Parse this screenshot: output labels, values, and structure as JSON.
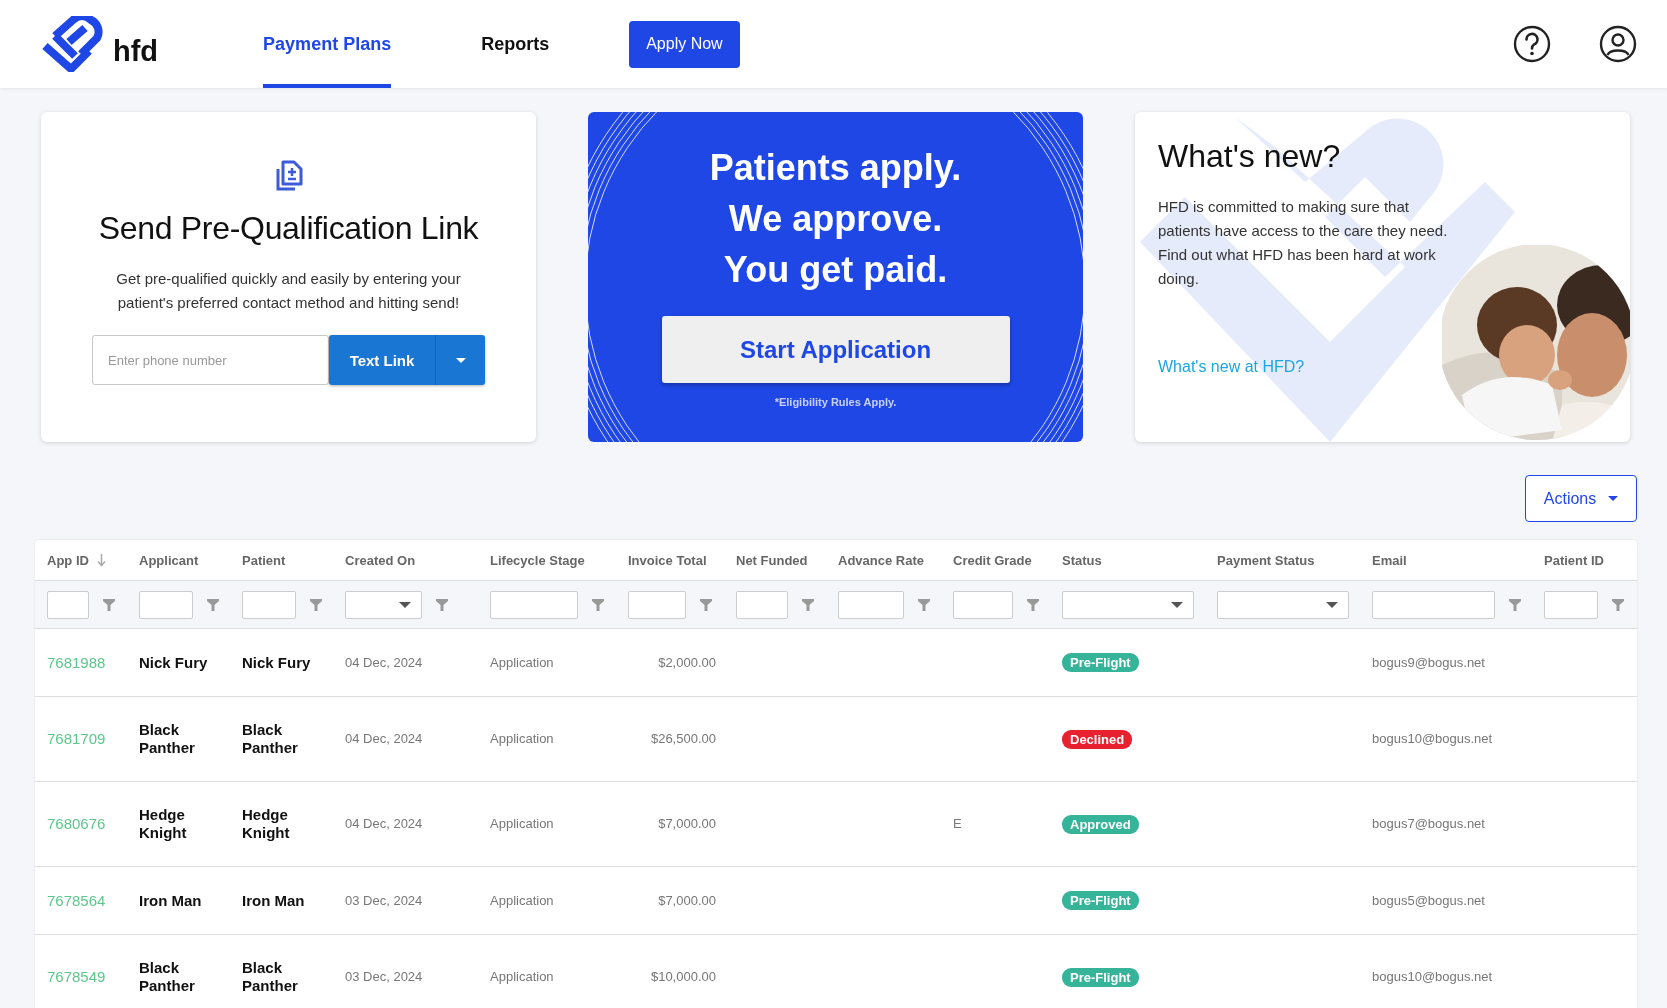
{
  "header": {
    "logo_text": "hfd",
    "nav": [
      {
        "label": "Payment Plans",
        "selected": true
      },
      {
        "label": "Reports",
        "selected": false
      }
    ],
    "apply_button": "Apply Now"
  },
  "prequal_card": {
    "title": "Send Pre-Qualification Link",
    "description": "Get pre-qualified quickly and easily by entering your patient's preferred contact method and hitting send!",
    "phone_placeholder": "Enter phone number",
    "button": "Text Link"
  },
  "promo_card": {
    "lines": [
      "Patients apply.",
      "We approve.",
      "You get paid."
    ],
    "button": "Start Application",
    "footnote": "*Eligibility Rules Apply."
  },
  "news_card": {
    "title": "What's new?",
    "body": "HFD is committed to making sure that patients have access to the care they need. Find out what HFD has been hard at work doing.",
    "link": "What's new at HFD?"
  },
  "actions_button": "Actions",
  "table": {
    "columns": [
      {
        "label": "App ID",
        "sorted": true,
        "kind": "text"
      },
      {
        "label": "Applicant",
        "sorted": false,
        "kind": "text"
      },
      {
        "label": "Patient",
        "sorted": false,
        "kind": "text"
      },
      {
        "label": "Created On",
        "sorted": false,
        "kind": "date"
      },
      {
        "label": "Lifecycle Stage",
        "sorted": false,
        "kind": "text"
      },
      {
        "label": "Invoice Total",
        "sorted": false,
        "kind": "text"
      },
      {
        "label": "Net Funded",
        "sorted": false,
        "kind": "text"
      },
      {
        "label": "Advance Rate",
        "sorted": false,
        "kind": "text"
      },
      {
        "label": "Credit Grade",
        "sorted": false,
        "kind": "text"
      },
      {
        "label": "Status",
        "sorted": false,
        "kind": "choice"
      },
      {
        "label": "Payment Status",
        "sorted": false,
        "kind": "choice"
      },
      {
        "label": "Email",
        "sorted": false,
        "kind": "text"
      },
      {
        "label": "Patient ID",
        "sorted": false,
        "kind": "text"
      }
    ],
    "rows": [
      {
        "app_id": "7681988",
        "applicant": "Nick Fury",
        "patient": "Nick Fury",
        "created_on": "04 Dec, 2024",
        "lifecycle_stage": "Application",
        "invoice_total": "$2,000.00",
        "status": {
          "label": "Pre-Flight",
          "color": "#35b49a"
        },
        "email": "bogus9@bogus.net"
      },
      {
        "app_id": "7681709",
        "applicant": "Black Panther",
        "patient": "Black Panther",
        "created_on": "04 Dec, 2024",
        "lifecycle_stage": "Application",
        "invoice_total": "$26,500.00",
        "status": {
          "label": "Declined",
          "color": "#e8212f"
        },
        "email": "bogus10@bogus.net"
      },
      {
        "app_id": "7680676",
        "applicant": "Hedge Knight",
        "patient": "Hedge Knight",
        "created_on": "04 Dec, 2024",
        "lifecycle_stage": "Application",
        "invoice_total": "$7,000.00",
        "credit_grade": "E",
        "status": {
          "label": "Approved",
          "color": "#35b49a"
        },
        "email": "bogus7@bogus.net"
      },
      {
        "app_id": "7678564",
        "applicant": "Iron Man",
        "patient": "Iron Man",
        "created_on": "03 Dec, 2024",
        "lifecycle_stage": "Application",
        "invoice_total": "$7,000.00",
        "status": {
          "label": "Pre-Flight",
          "color": "#35b49a"
        },
        "email": "bogus5@bogus.net"
      },
      {
        "app_id": "7678549",
        "applicant": "Black Panther",
        "patient": "Black Panther",
        "created_on": "03 Dec, 2024",
        "lifecycle_stage": "Application",
        "invoice_total": "$10,000.00",
        "status": {
          "label": "Pre-Flight",
          "color": "#35b49a"
        },
        "email": "bogus10@bogus.net"
      }
    ]
  }
}
